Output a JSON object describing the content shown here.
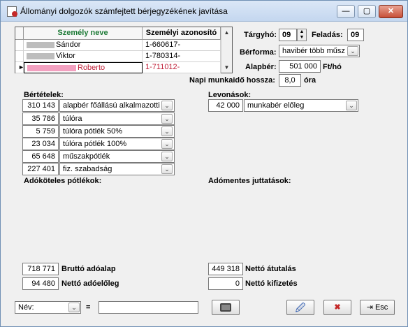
{
  "window": {
    "title": "Állományi dolgozók számfejtett bérjegyzékének javítása",
    "min": "—",
    "max": "▢",
    "close": "✕"
  },
  "grid": {
    "col_name": "Személy neve",
    "col_id": "Személyi azonosító",
    "rows": [
      {
        "name": "Sándor",
        "id": "1-660617-"
      },
      {
        "name": "Viktor",
        "id": "1-780314-"
      },
      {
        "name": "Roberto",
        "id": "1-711012-"
      }
    ]
  },
  "top": {
    "targyho_label": "Tárgyhó:",
    "targyho": "09",
    "feladas_label": "Feladás:",
    "feladas": "09",
    "berforma_label": "Bérforma:",
    "berforma": "havibér több műsz",
    "alapber_label": "Alapbér:",
    "alapber": "501 000",
    "alapber_unit": "Ft/hó",
    "napi_label": "Napi munkaidő hossza:",
    "napi": "8,0",
    "napi_unit": "óra"
  },
  "bertetelek": {
    "label": "Bértételek:",
    "items": [
      {
        "value": "310 143",
        "text": "alapbér főállású alkalmazotti"
      },
      {
        "value": "35 786",
        "text": "túlóra"
      },
      {
        "value": "5 759",
        "text": "túlóra pótlék 50%"
      },
      {
        "value": "23 034",
        "text": "túlóra pótlék 100%"
      },
      {
        "value": "65 648",
        "text": "műszakpótlék"
      },
      {
        "value": "227 401",
        "text": "fiz. szabadság"
      }
    ]
  },
  "levonasok": {
    "label": "Levonások:",
    "items": [
      {
        "value": "42 000",
        "text": "munkabér előleg"
      }
    ]
  },
  "adokoteles_label": "Adóköteles pótlékok:",
  "adomentes_label": "Adómentes juttatások:",
  "totals": {
    "brutto": "718 771",
    "brutto_label": "Bruttó adóalap",
    "netto_elo": "94 480",
    "netto_elo_label": "Nettó adóelőleg",
    "netto_atut": "449 318",
    "netto_atut_label": "Nettó átutalás",
    "netto_kifiz": "0",
    "netto_kifiz_label": "Nettó kifizetés"
  },
  "footer": {
    "filter_field": "Név:",
    "eq": "=",
    "esc": "Esc"
  }
}
